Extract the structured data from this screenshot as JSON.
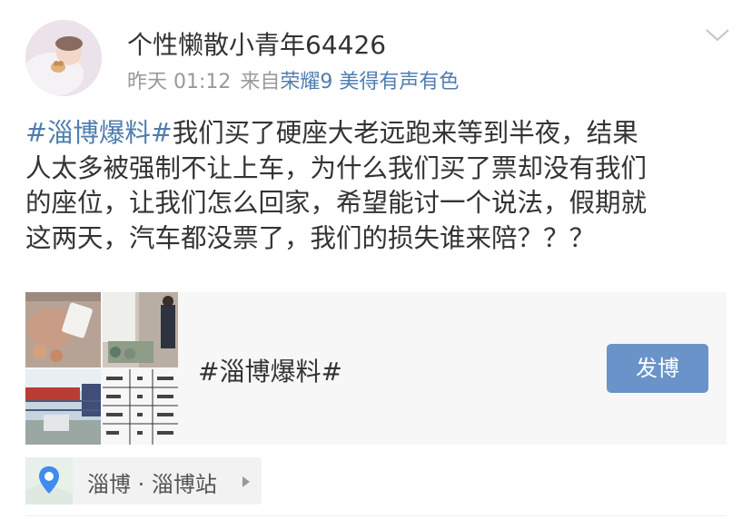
{
  "post": {
    "username": "个性懒散小青年64426",
    "time": "昨天 01:12",
    "source_prefix": "来自",
    "source": "荣耀9 美得有声有色",
    "lines": [
      {
        "tag": "#淄博爆料#",
        "text": "我们买了硬座大老远跑来等到半夜，结果"
      },
      {
        "tag": "",
        "text": "人太多被强制不让上车，为什么我们买了票却没有我们"
      },
      {
        "tag": "",
        "text": "的座位，让我们怎么回家，希望能讨一个说法，假期就"
      },
      {
        "tag": "",
        "text": "这两天，汽车都没票了，我们的损失谁来陪？？？"
      }
    ]
  },
  "topic_card": {
    "title": "#淄博爆料#",
    "button_label": "发博"
  },
  "location": {
    "label": "淄博 · 淄博站"
  },
  "colors": {
    "link": "#507daf",
    "button": "#6a93c9",
    "card_bg": "#f7f7f7",
    "meta_gray": "#999999"
  },
  "icons": {
    "more": "chevron-down-icon",
    "location": "map-pin-icon",
    "arrow": "triangle-right-icon"
  }
}
